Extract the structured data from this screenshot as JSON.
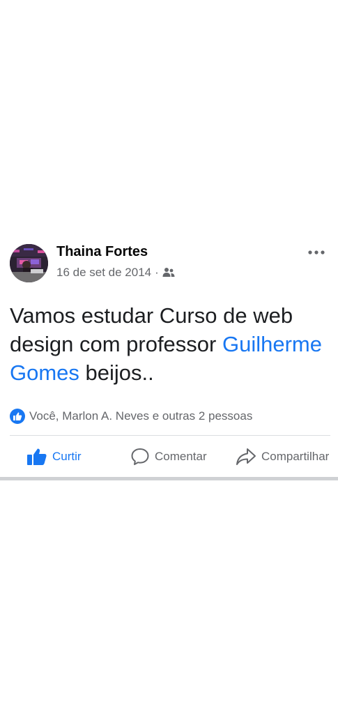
{
  "post": {
    "author": "Thaina Fortes",
    "date": "16 de set de 2014",
    "separator": "·",
    "audience_icon": "friends-icon",
    "more_icon": "more-options-icon",
    "text": {
      "before_mention": "Vamos estudar Curso de web design com professor",
      "mention": "Guilherme Gomes",
      "after_mention": "beijos.."
    },
    "reactions": {
      "icon": "like-badge-icon",
      "text": "Você, Marlon A. Neves e outras 2 pessoas"
    },
    "actions": {
      "like_label": "Curtir",
      "comment_label": "Comentar",
      "share_label": "Compartilhar"
    }
  },
  "colors": {
    "accent": "#1877f2",
    "secondary_text": "#65676b",
    "primary_text": "#050505"
  }
}
